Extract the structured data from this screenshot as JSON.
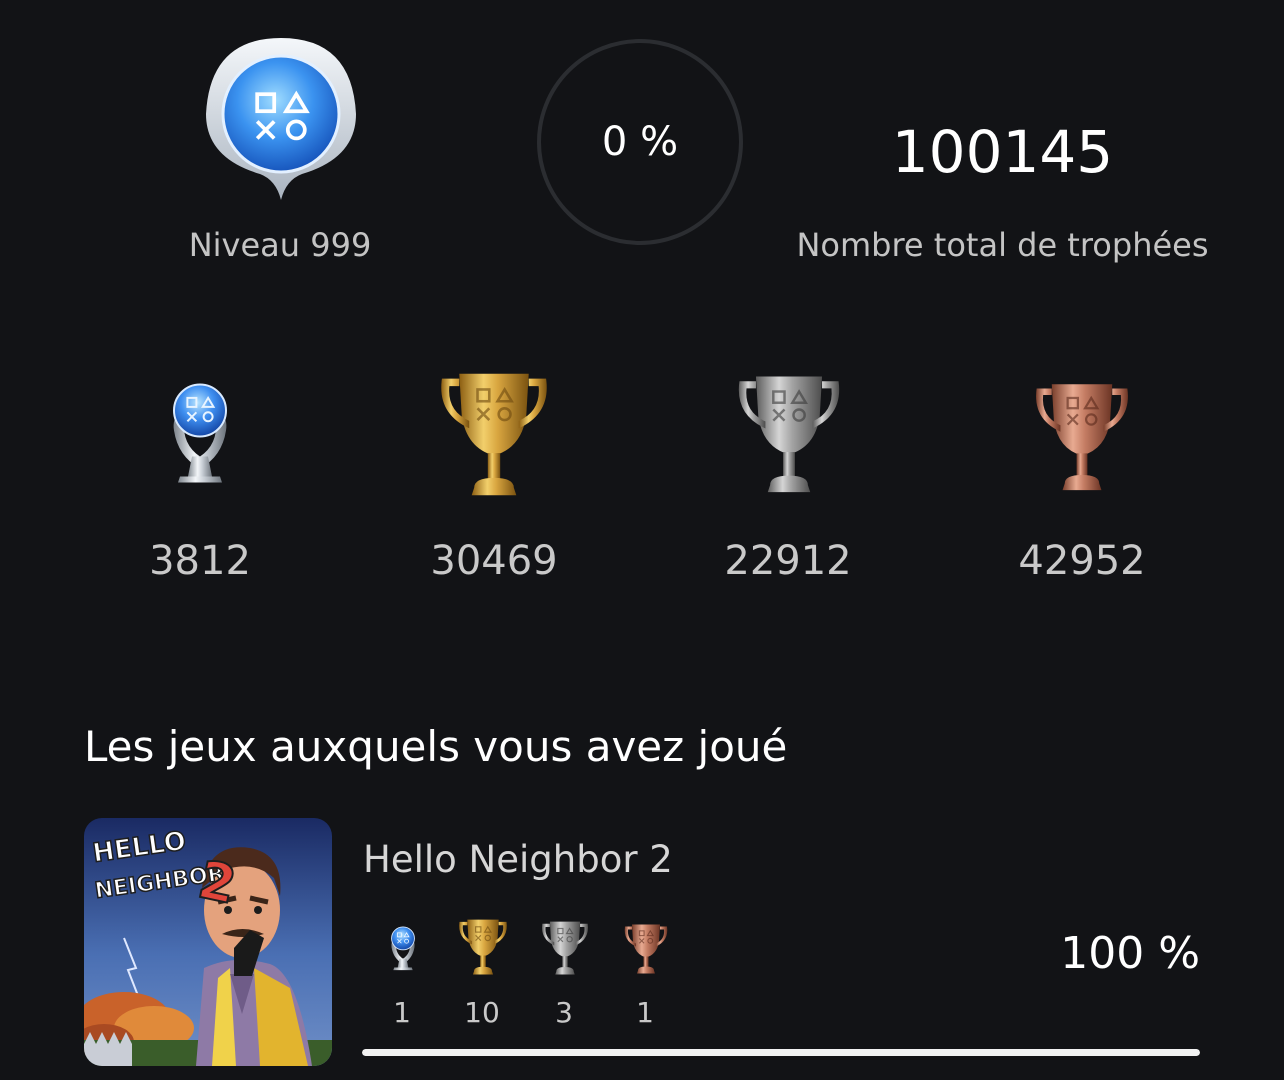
{
  "summary": {
    "level_label": "Niveau 999",
    "progress_text": "0 %",
    "progress_value": 0,
    "total_trophies_value": "100145",
    "total_trophies_label": "Nombre total de trophées"
  },
  "trophies": {
    "platinum": "3812",
    "gold": "30469",
    "silver": "22912",
    "bronze": "42952"
  },
  "played_section": {
    "title": "Les jeux auxquels vous avez joué",
    "games": [
      {
        "title": "Hello Neighbor 2",
        "thumbnail_text_line1": "HELLO",
        "thumbnail_text_line2": "NEIGHBOR",
        "thumbnail_number": "2",
        "platinum": "1",
        "gold": "10",
        "silver": "3",
        "bronze": "1",
        "completion_text": "100 %",
        "completion_value": 1.0
      }
    ]
  },
  "colors": {
    "background": "#121316",
    "gold": "#c9962c",
    "silver": "#9a9a9a",
    "bronze": "#b9735c",
    "platinum_blue": "#3d8fe6"
  }
}
